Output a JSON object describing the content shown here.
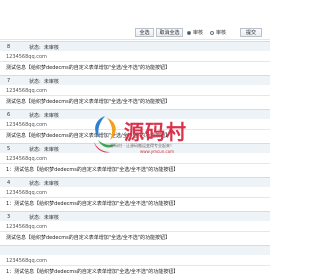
{
  "toolbar": {
    "select_all": "全选",
    "deselect_all": "取消全选",
    "filter_approved": "审核",
    "filter_pending": "审核",
    "submit": "提交"
  },
  "entries": [
    {
      "num": "8",
      "state_label": "状态:",
      "state": "未审核",
      "email": "1234568qq.com",
      "message": "测试信息【给织梦dedecms的自定义表单增加\"全选/全不选\"的功能按钮】"
    },
    {
      "num": "7",
      "state_label": "状态:",
      "state": "未审核",
      "email": "1234568qq.com",
      "message": "测试信息【给织梦dedecms的自定义表单增加\"全选/全不选\"的功能按钮】"
    },
    {
      "num": "6",
      "state_label": "状态:",
      "state": "未审核",
      "email": "1234568qq.com",
      "message": "测试信息【给织梦dedecms的自定义表单增加\"全选/全不选\"的功能按钮】"
    },
    {
      "num": "5",
      "state_label": "状态:",
      "state": "未审核",
      "email": "1234568qq.com",
      "message": "1：测试信息【给织梦dedecms的自定义表单增加\"全选/全不选\"的功能按钮】"
    },
    {
      "num": "4",
      "state_label": "状态:",
      "state": "未审核",
      "email": "1234568qq.com",
      "message": "1：测试信息【给织梦dedecms的自定义表单增加\"全选/全不选\"的功能按钮】"
    },
    {
      "num": "3",
      "state_label": "状态:",
      "state": "未审核",
      "email": "1234568qq.com",
      "message": "测试信息【给织梦dedecms的自定义表单增加\"全选/全不选\"的功能按钮】"
    },
    {
      "num": "",
      "state_label": "",
      "state": "",
      "email": "1234568qq.com",
      "message": "1：测试信息【给织梦dedecms的自定义表单增加\"全选/全不选\"的功能按钮】"
    }
  ],
  "watermark": {
    "brand": "源码村",
    "slogan": "源码村 - 让源码搬运变得专业起来！",
    "url": "www.ymcun.com",
    "colors": {
      "red": "#d9334b",
      "blue": "#2f7fd0",
      "orange": "#f2a01b",
      "green": "#3aa84a"
    }
  },
  "colors": {
    "row_header_bg": "#eef3f7",
    "border": "#d3dde6"
  }
}
